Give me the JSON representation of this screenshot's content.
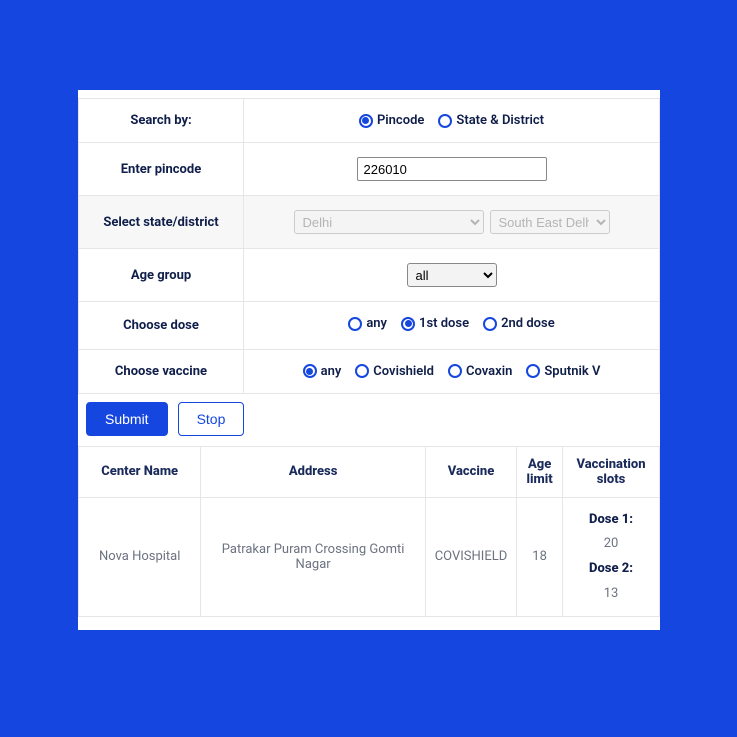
{
  "form": {
    "searchByLabel": "Search by:",
    "searchBy": {
      "pincode": "Pincode",
      "stateDistrict": "State & District",
      "selected": "pincode"
    },
    "pincodeLabel": "Enter pincode",
    "pincodeValue": "226010",
    "stateDistrictLabel": "Select state/district",
    "stateValue": "Delhi",
    "districtValue": "South East Delhi",
    "ageGroupLabel": "Age group",
    "ageGroupValue": "all",
    "doseLabel": "Choose dose",
    "dose": {
      "any": "any",
      "first": "1st dose",
      "second": "2nd dose",
      "selected": "first"
    },
    "vaccineLabel": "Choose vaccine",
    "vaccine": {
      "any": "any",
      "covishield": "Covishield",
      "covaxin": "Covaxin",
      "sputnik": "Sputnik V",
      "selected": "any"
    }
  },
  "buttons": {
    "submit": "Submit",
    "stop": "Stop"
  },
  "results": {
    "headers": {
      "center": "Center Name",
      "address": "Address",
      "vaccine": "Vaccine",
      "ageLimit": "Age limit",
      "slots": "Vaccination slots"
    },
    "row": {
      "center": "Nova Hospital",
      "address": "Patrakar Puram Crossing Gomti Nagar",
      "vaccine": "COVISHIELD",
      "ageLimit": "18",
      "dose1Label": "Dose 1:",
      "dose1Value": "20",
      "dose2Label": "Dose 2:",
      "dose2Value": "13"
    }
  }
}
